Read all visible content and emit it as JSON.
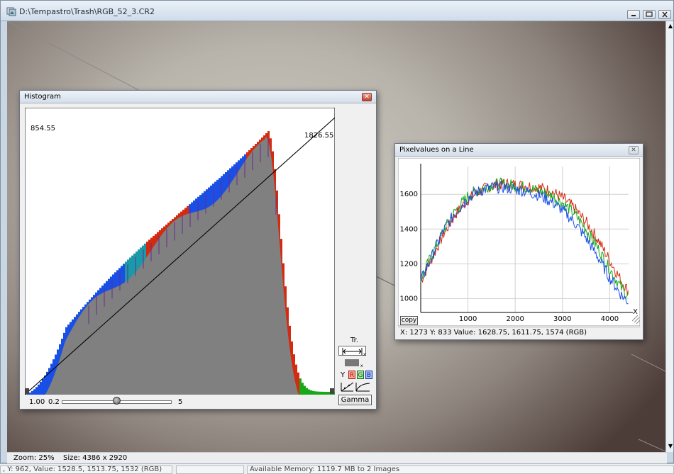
{
  "main_window": {
    "title": "D:\\Tempastro\\Trash\\RGB_52_3.CR2",
    "status": {
      "zoom": "Zoom: 25%",
      "size": "Size: 4386 x 2920"
    }
  },
  "app_status": {
    "cell1": ", Y: 962, Value: 1528.5, 1513.75, 1532 (RGB)",
    "cell2": "",
    "cell3": "Available Memory: 1119.7 MB to 2 Images"
  },
  "histogram": {
    "title": "Histogram",
    "left_value": "854.55",
    "right_value": "1826.55",
    "min_value": "1.00",
    "slider": {
      "min_label": "0.2",
      "max_label": "5",
      "value_fraction": 0.5
    },
    "tr_label": "Tr.",
    "channel_label": "Y",
    "channels": [
      "R",
      "G",
      "B"
    ],
    "gamma_button": "Gamma",
    "colors": {
      "gray": "#808080",
      "red": "#d42a10",
      "green": "#1aa81a",
      "blue": "#1a4fe6",
      "teal": "#1a9aa8"
    }
  },
  "pixel_line": {
    "title": "Pixelvalues on a Line",
    "copy_button": "copy",
    "readout": "X: 1273  Y: 833  Value: 1628.75, 1611.75, 1574 (RGB)",
    "chart_data": {
      "type": "line",
      "title": "Pixelvalues on a Line",
      "xlabel": "X",
      "ylabel": "",
      "xlim": [
        0,
        4400
      ],
      "ylim": [
        920,
        1760
      ],
      "xticks": [
        1000,
        2000,
        3000,
        4000
      ],
      "yticks": [
        1000,
        1200,
        1400,
        1600
      ],
      "grid": true,
      "x": [
        0,
        250,
        500,
        750,
        1000,
        1250,
        1500,
        1750,
        2000,
        2250,
        2500,
        2750,
        3000,
        3250,
        3500,
        3750,
        4000,
        4250,
        4400
      ],
      "series": [
        {
          "name": "R",
          "color": "#d42a10",
          "values": [
            1100,
            1240,
            1380,
            1490,
            1570,
            1620,
            1650,
            1660,
            1655,
            1650,
            1640,
            1620,
            1580,
            1520,
            1440,
            1340,
            1220,
            1100,
            1040
          ]
        },
        {
          "name": "G",
          "color": "#1aa81a",
          "values": [
            1110,
            1260,
            1400,
            1510,
            1590,
            1630,
            1655,
            1660,
            1650,
            1640,
            1620,
            1595,
            1550,
            1490,
            1400,
            1290,
            1170,
            1060,
            1010
          ]
        },
        {
          "name": "B",
          "color": "#1a4fe6",
          "values": [
            1100,
            1250,
            1400,
            1500,
            1580,
            1620,
            1640,
            1640,
            1630,
            1615,
            1595,
            1560,
            1510,
            1440,
            1350,
            1240,
            1120,
            1020,
            980
          ]
        }
      ]
    }
  }
}
